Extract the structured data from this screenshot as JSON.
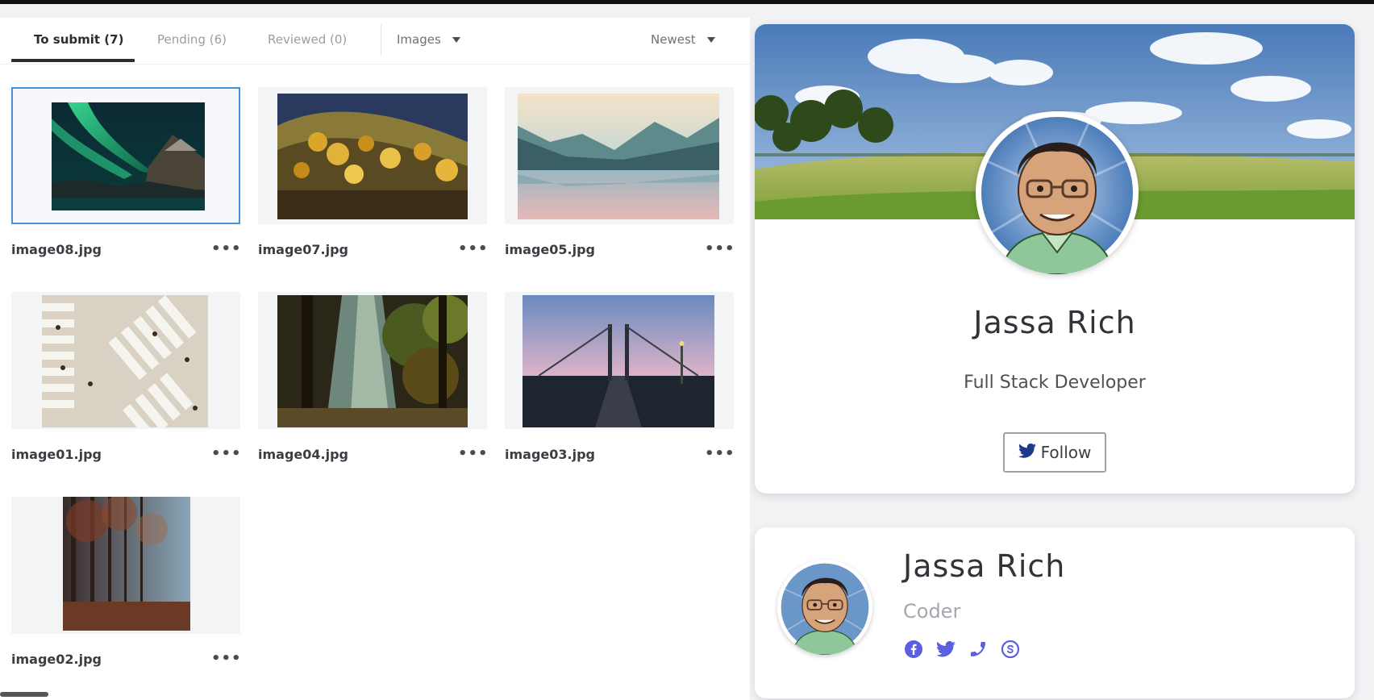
{
  "tabs": [
    {
      "label": "To submit (7)"
    },
    {
      "label": "Pending (6)"
    },
    {
      "label": "Reviewed (0)"
    }
  ],
  "filter": {
    "label": "Images"
  },
  "sort": {
    "label": "Newest"
  },
  "images": [
    {
      "filename": "image08.jpg",
      "menu": "•••"
    },
    {
      "filename": "image07.jpg",
      "menu": "•••"
    },
    {
      "filename": "image05.jpg",
      "menu": "•••"
    },
    {
      "filename": "image01.jpg",
      "menu": "•••"
    },
    {
      "filename": "image04.jpg",
      "menu": "•••"
    },
    {
      "filename": "image03.jpg",
      "menu": "•••"
    },
    {
      "filename": "image02.jpg",
      "menu": "•••"
    }
  ],
  "profile_card": {
    "name": "Jassa Rich",
    "role": "Full Stack Developer",
    "follow_label": "Follow"
  },
  "profile_compact": {
    "name": "Jassa Rich",
    "role": "Coder",
    "socials": [
      "facebook-icon",
      "twitter-icon",
      "phone-icon",
      "skype-icon"
    ]
  },
  "colors": {
    "selected_border": "#4a90d9",
    "social_accent": "#5b5fe0",
    "twitter_blue": "#1d3a8a"
  }
}
